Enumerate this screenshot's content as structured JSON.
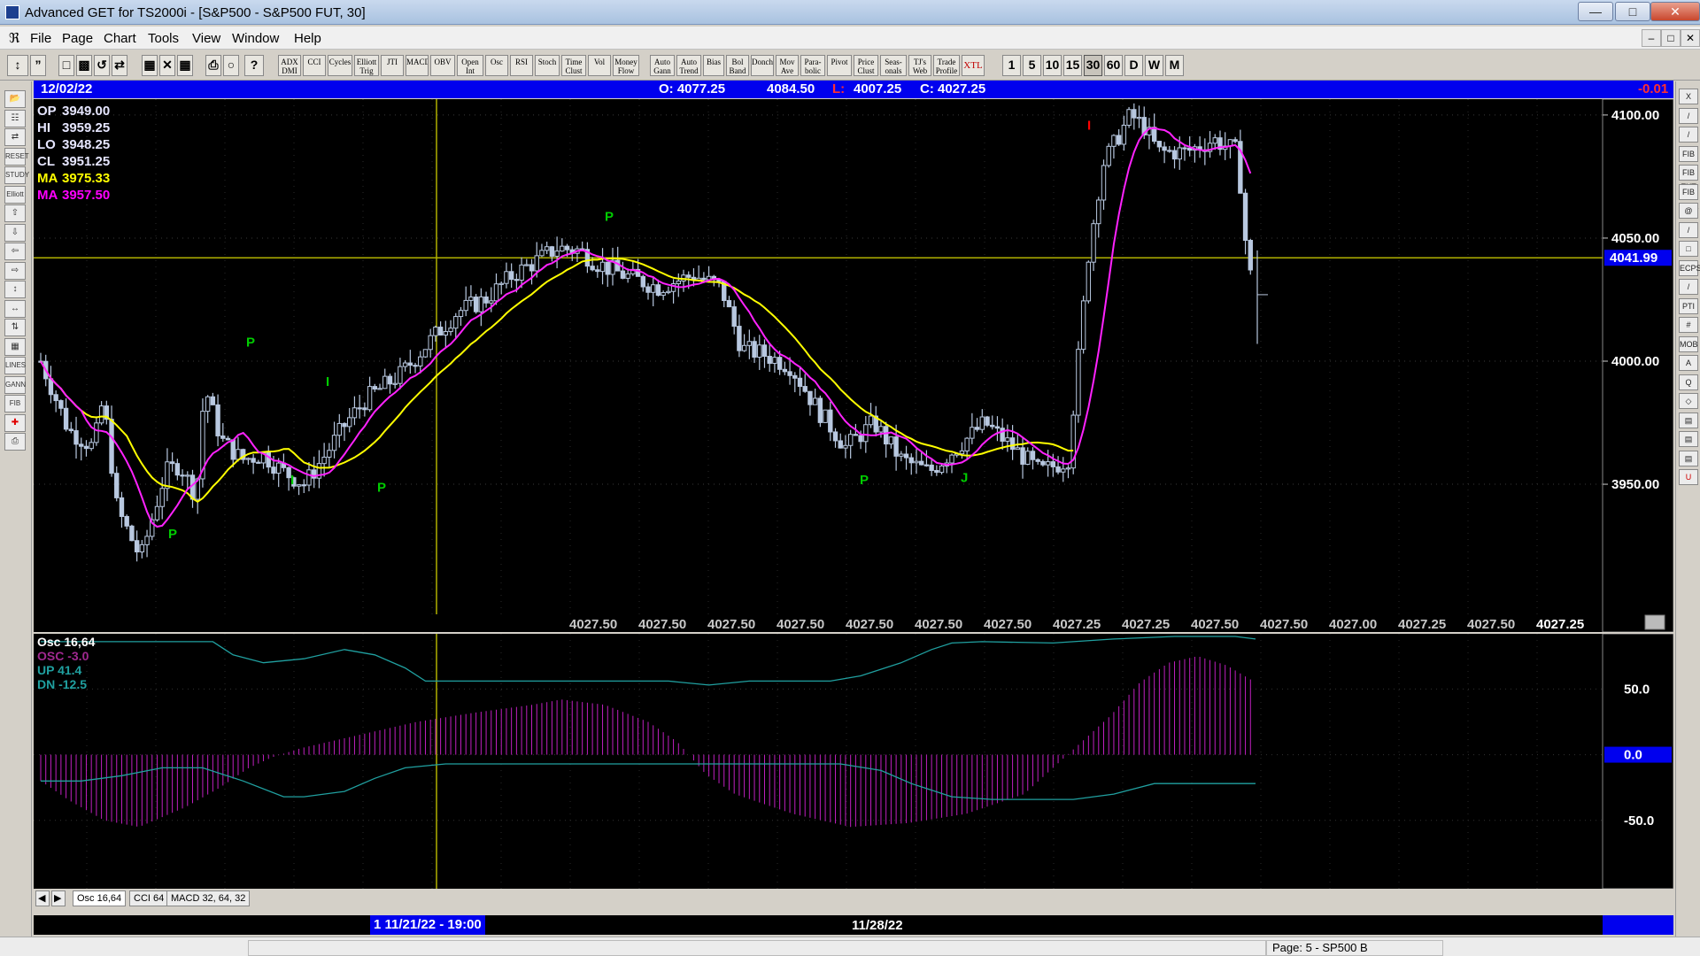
{
  "window": {
    "title": "Advanced GET for TS2000i - [S&P500 - S&P500 FUT, 30]",
    "min": "—",
    "max": "□",
    "close": "✕"
  },
  "menu": {
    "items": [
      "File",
      "Page",
      "Chart",
      "Tools",
      "View",
      "Window",
      "Help"
    ],
    "mdi": [
      "–",
      "□",
      "✕"
    ]
  },
  "toolbar": {
    "studies": [
      "ADX DMI",
      "CCI",
      "Cycles",
      "Elliott Trig",
      "JTI",
      "MACD",
      "OBV",
      "Open Int",
      "Osc",
      "RSI",
      "Stoch",
      "Time Clust",
      "Vol",
      "Money Flow",
      "Auto Gann",
      "Auto Trend",
      "Bias",
      "Bol Band",
      "Donch",
      "Mov Ave",
      "Para-bolic",
      "Pivot",
      "Price Clust",
      "Seas-onals",
      "TJ's Web",
      "Trade Profile",
      "XTL"
    ],
    "intervals": [
      "1",
      "5",
      "10",
      "15",
      "30",
      "60",
      "D",
      "W",
      "M"
    ],
    "active_interval": "30"
  },
  "left_tools": [
    "open-folder-icon",
    "zoom-in-icon",
    "compress-icon",
    "reset-icon",
    "study-icon",
    "elliott-icon",
    "arrow-up-icon",
    "arrow-down-icon",
    "arrow-left-icon",
    "arrow-right-icon",
    "scale-icon",
    "expand-icon",
    "contract-icon",
    "grid-icon",
    "lines-icon",
    "gann-icon",
    "fib-icon",
    "crosshair-icon",
    "print-icon"
  ],
  "left_tool_labels": [
    "",
    "",
    "",
    "RESET",
    "STUDY",
    "Elliott",
    "",
    "",
    "",
    "",
    "",
    "",
    "",
    "",
    "LINES",
    "GANN",
    "FIB",
    "",
    ""
  ],
  "right_tools": [
    "X",
    "/",
    "/",
    "FIB RET",
    "FIB EXT",
    "FIB TIME",
    "@",
    "/",
    "□",
    "ECPS",
    "/",
    "PTI",
    "#",
    "MOB",
    "A",
    "Q",
    "◇",
    "▤",
    "▤",
    "▤",
    "U"
  ],
  "info_bar": {
    "date": "12/02/22",
    "open": "O: 4077.25",
    "high": "4084.50",
    "low_label": "L:",
    "low": "4007.25",
    "close": "C: 4027.25",
    "change": "-0.01"
  },
  "price_panel": {
    "legend": [
      {
        "label": "OP",
        "value": "3949.00",
        "color": "#e6e6ff"
      },
      {
        "label": "HI",
        "value": "3959.25",
        "color": "#e6e6ff"
      },
      {
        "label": "LO",
        "value": "3948.25",
        "color": "#e6e6ff"
      },
      {
        "label": "CL",
        "value": "3951.25",
        "color": "#e6e6ff"
      },
      {
        "label": "MA",
        "value": "3975.33",
        "color": "#ffff00"
      },
      {
        "label": "MA",
        "value": "3957.50",
        "color": "#ff00ff"
      }
    ],
    "axis_labels": [
      "4100.00",
      "4050.00",
      "4000.00",
      "3950.00"
    ],
    "current_price": "4041.99",
    "bottom_prices": [
      "4027.50",
      "4027.50",
      "4027.50",
      "4027.50",
      "4027.50",
      "4027.50",
      "4027.50",
      "4027.25",
      "4027.25",
      "4027.50",
      "4027.50",
      "4027.00",
      "4027.25",
      "4027.50",
      "4027.25"
    ],
    "pivot_marks": [
      {
        "letter": "P",
        "price": 3928,
        "color": "#00cc00"
      },
      {
        "letter": "P",
        "price": 4006,
        "color": "#00cc00"
      },
      {
        "letter": "I",
        "price": 3950,
        "color": "#00cc00"
      },
      {
        "letter": "I",
        "price": 3990,
        "color": "#00cc00"
      },
      {
        "letter": "P",
        "price": 3947,
        "color": "#00cc00"
      },
      {
        "letter": "P",
        "price": 4057,
        "color": "#00cc00"
      },
      {
        "letter": "P",
        "price": 3950,
        "color": "#00cc00"
      },
      {
        "letter": "J",
        "price": 3951,
        "color": "#00cc00"
      },
      {
        "letter": "I",
        "price": 4094,
        "color": "#ff0000"
      }
    ],
    "colors": {
      "candles": "#b8c8e0",
      "ma_fast": "#ffff00",
      "ma_slow": "#ff22ff",
      "cursor": "#b0b000"
    }
  },
  "osc_panel": {
    "legend": [
      {
        "label": "Osc 16,64",
        "color": "#ffffff"
      },
      {
        "label": "OSC -3.0",
        "color": "#a02890"
      },
      {
        "label": "UP   41.4",
        "color": "#20a0a0"
      },
      {
        "label": "DN   -12.5",
        "color": "#20a0a0"
      }
    ],
    "axis_labels": [
      "50.0",
      "0.0",
      "-50.0"
    ],
    "colors": {
      "histogram": "#c020c0",
      "bands": "#20a0a0"
    }
  },
  "panel_tabs": [
    "Osc 16,64",
    "CCI 64",
    "MACD 32, 64, 32"
  ],
  "time_bar": {
    "cursor_label": "1 11/21/22 - 19:00",
    "date2": "11/28/22"
  },
  "status": {
    "page": "Page: 5 - SP500 B"
  }
}
